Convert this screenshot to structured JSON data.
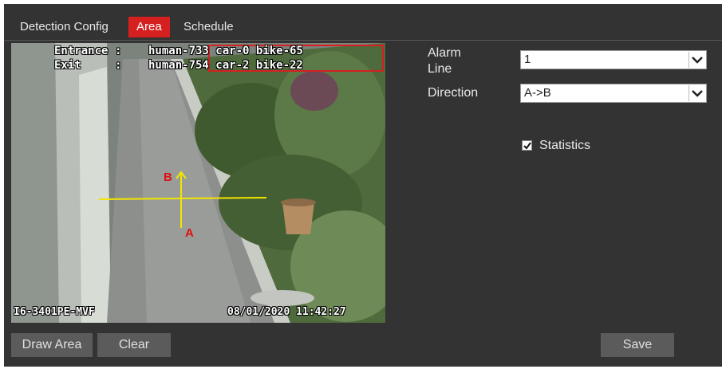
{
  "tabs": [
    {
      "label": "Detection Config",
      "active": false
    },
    {
      "label": "Area",
      "active": true
    },
    {
      "label": "Schedule",
      "active": false
    }
  ],
  "video": {
    "entrance_label": "Entrance",
    "entrance_counts": "human-733 car-0 bike-65",
    "exit_label": "Exit",
    "exit_counts": "human-754 car-2 bike-22",
    "camera_name": "I6-3401PE-MVF",
    "timestamp": "08/01/2020 11:42:27",
    "point_a": "A",
    "point_b": "B"
  },
  "settings": {
    "alarm_line_label": "Alarm Line",
    "alarm_line_value": "1",
    "direction_label": "Direction",
    "direction_value": "A->B",
    "statistics_label": "Statistics",
    "statistics_checked": true
  },
  "buttons": {
    "draw_area": "Draw Area",
    "clear": "Clear",
    "save": "Save"
  },
  "colors": {
    "accent": "#d61f1f",
    "background": "#333333",
    "line": "#f2e600"
  }
}
